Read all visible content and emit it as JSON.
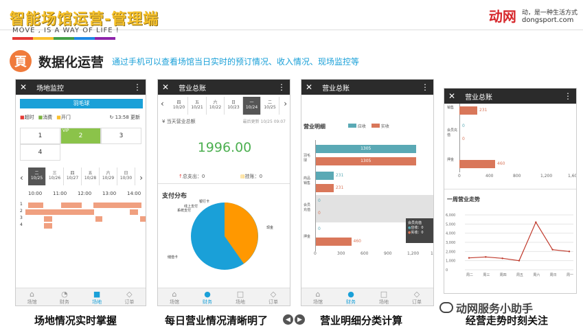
{
  "header": {
    "title": "智能场馆运营-管理端",
    "slogan": "MOVE , IS A WAY OF LIFE !",
    "brand_logo": "动网",
    "brand_tag": "动，是一种生活方式",
    "brand_site": "dongsport.com"
  },
  "section": {
    "icon_glyph": "頁",
    "title": "数据化运营",
    "desc": "通过手机可以查看场馆当日实时的预订情况、收入情况、现场监控等"
  },
  "phone1": {
    "title": "场地监控",
    "sport": "羽毛球",
    "legend": [
      "超时",
      "消费",
      "开门"
    ],
    "time": "13:58 更新",
    "courts": [
      "1",
      "2",
      "3",
      "4"
    ],
    "vip": "VIP",
    "days": [
      {
        "w": "二",
        "d": "10/25"
      },
      {
        "w": "三",
        "d": "10/26"
      },
      {
        "w": "四",
        "d": "10/27"
      },
      {
        "w": "五",
        "d": "10/28"
      },
      {
        "w": "六",
        "d": "10/29"
      },
      {
        "w": "日",
        "d": "10/30"
      }
    ],
    "hours": [
      "10:00",
      "11:00",
      "12:00",
      "13:00",
      "14:00"
    ],
    "rows": [
      "1",
      "2",
      "3",
      "4"
    ]
  },
  "phone2": {
    "title": "营业总账",
    "days": [
      {
        "w": "四",
        "d": "10/20"
      },
      {
        "w": "五",
        "d": "10/21"
      },
      {
        "w": "六",
        "d": "10/22"
      },
      {
        "w": "日",
        "d": "10/23"
      },
      {
        "w": "一",
        "d": "10/24"
      },
      {
        "w": "二",
        "d": "10/25"
      }
    ],
    "summary_label": "¥ 当天营业总额",
    "updated": "最后更新 10/25 09:07",
    "total": "1996.00",
    "out_label": "总支出：0",
    "in_label": "挂账：0",
    "pie_title": "支付分布",
    "pie_labels": [
      "银行卡",
      "线上支付",
      "系统支付",
      "现金",
      "储值卡"
    ]
  },
  "phone3": {
    "title": "营业总账",
    "chart_title": "营业明细",
    "legend": [
      "应收",
      "实收"
    ],
    "cats": [
      "羽毛球",
      "商品销售",
      "会员充值",
      "押金"
    ],
    "values": [
      "1305",
      "1305",
      "231",
      "231",
      "0",
      "0",
      "0",
      "460"
    ],
    "axis": [
      "0",
      "300",
      "600",
      "900",
      "1,200",
      "1,50"
    ],
    "tooltip": {
      "title": "会员充值",
      "a": "应收：0",
      "b": "实收：0"
    }
  },
  "phone4": {
    "title": "营业总账",
    "cats": [
      "销售",
      "会员充值",
      "押金"
    ],
    "vals": [
      "231",
      "0",
      "0",
      "460"
    ],
    "axis": [
      "0",
      "400",
      "800",
      "1,200",
      "1,600"
    ],
    "trend_title": "一周营业走势",
    "yaxis": [
      "6,000",
      "5,000",
      "4,000",
      "3,000",
      "2,000",
      "1,000",
      "0"
    ],
    "xaxis": [
      "周二",
      "周三",
      "周四",
      "周五",
      "周六",
      "周日",
      "周一"
    ]
  },
  "tabs": [
    "场馆",
    "财务",
    "场地",
    "订单"
  ],
  "chart_data": {
    "type": "line",
    "title": "一周营业走势",
    "categories": [
      "周二",
      "周三",
      "周四",
      "周五",
      "周六",
      "周日",
      "周一"
    ],
    "values": [
      1300,
      1400,
      1250,
      1000,
      5200,
      2200,
      2000
    ],
    "ylim": [
      0,
      6000
    ]
  },
  "captions": [
    "场地情况实时掌握",
    "每日营业情况清晰明了",
    "营业明细分类计算",
    "经营走势时刻关注"
  ],
  "watermark": "动网服务小助手",
  "nav": {
    "prev": "◀",
    "next": "▶"
  },
  "colors": {
    "orange": "#f07b3c",
    "blue": "#1aa0d8",
    "teal": "#5aa9b5",
    "salmon": "#d9775a"
  }
}
